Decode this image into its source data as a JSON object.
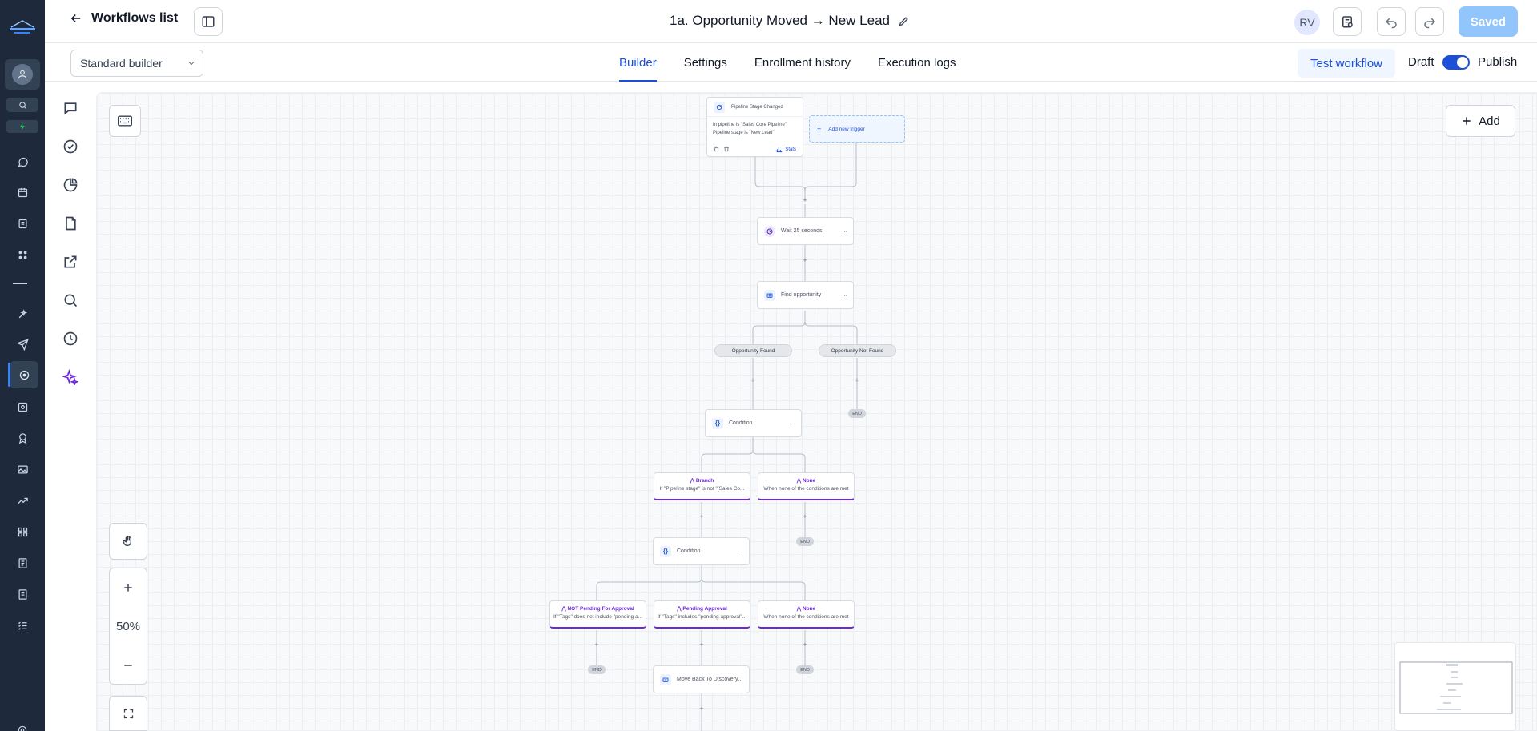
{
  "topbar": {
    "back_label": "Workflows list",
    "workflow_title": "1a. Opportunity Moved → New Lead",
    "user_initials": "RV",
    "saved_label": "Saved"
  },
  "subbar": {
    "builder_select": "Standard builder",
    "tabs": [
      "Builder",
      "Settings",
      "Enrollment history",
      "Execution logs"
    ],
    "active_tab": "Builder",
    "test_workflow_label": "Test workflow",
    "draft_label": "Draft",
    "publish_label": "Publish"
  },
  "canvas": {
    "add_label": "Add",
    "zoom_level": "50%"
  },
  "flow": {
    "trigger": {
      "title": "Pipeline Stage Changed",
      "line1": "In pipeline is \"Sales Core Pipeline\"",
      "line2": "Pipeline stage is \"New Lead\"",
      "stats_label": "Stats"
    },
    "add_trigger_label": "Add new trigger",
    "wait_label": "Wait 25 seconds",
    "find_label": "Find opportunity",
    "found_label": "Opportunity Found",
    "not_found_label": "Opportunity Not Found",
    "condition1_label": "Condition",
    "branch1": {
      "title": "Branch",
      "desc": "If \"Pipeline stage\" is not \"[Sales Co..."
    },
    "none1": {
      "title": "None",
      "desc": "When none of the conditions are met"
    },
    "condition2_label": "Condition",
    "branch_npa": {
      "title": "NOT Pending For Approval",
      "desc": "If \"Tags\" does not include \"pending a..."
    },
    "branch_pa": {
      "title": "Pending Approval",
      "desc": "If \"Tags\" includes \"pending approval\"..."
    },
    "none2": {
      "title": "None",
      "desc": "When none of the conditions are met"
    },
    "move_label": "Move Back To Discovery",
    "end_label": "END"
  },
  "colors": {
    "rail_bg": "#1e293b",
    "accent": "#1d4ed8",
    "branch_accent": "#6d28d9",
    "saved_bg": "#93c5fd"
  }
}
